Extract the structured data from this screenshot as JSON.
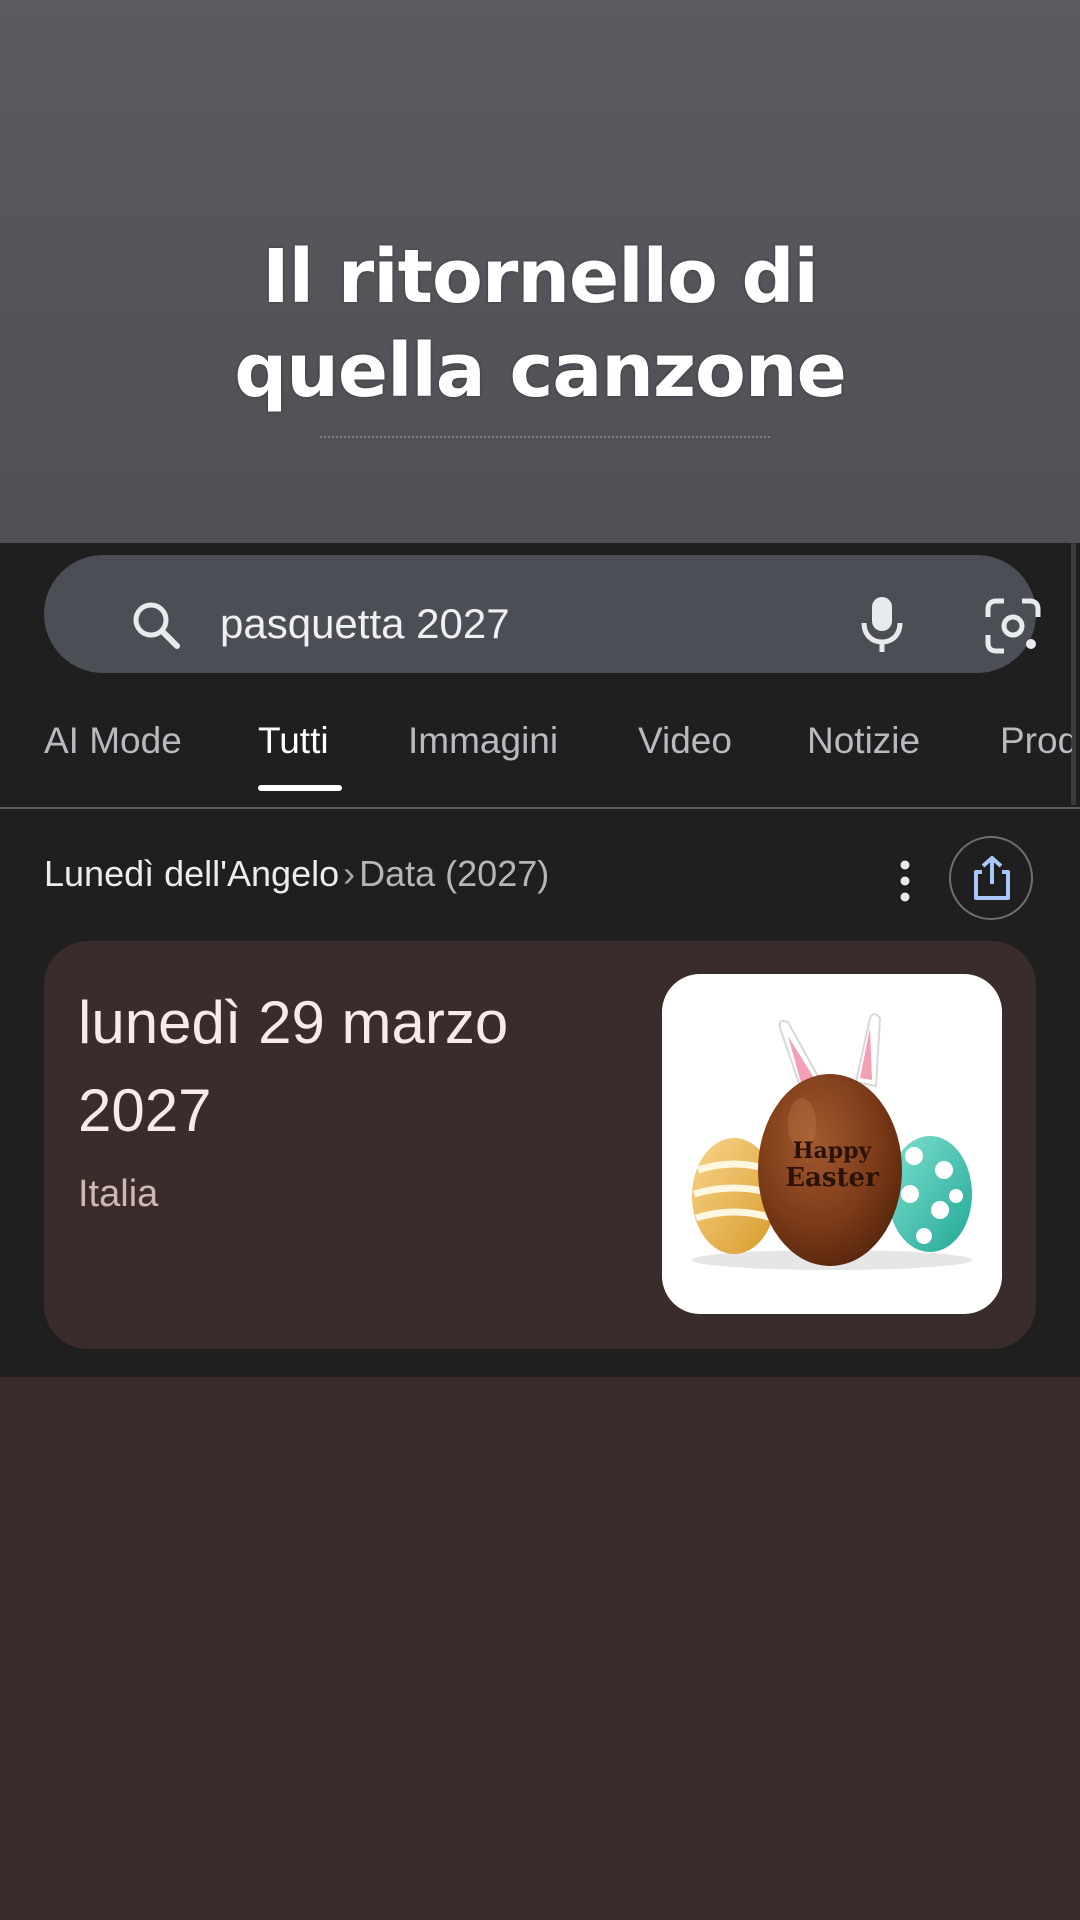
{
  "banner": {
    "caption_line1": "Il ritornello di",
    "caption_line2": "quella canzone"
  },
  "search": {
    "query": "pasquetta 2027",
    "icons": [
      "search-icon",
      "mic-icon",
      "lens-icon"
    ]
  },
  "tabs": [
    {
      "label": "AI Mode",
      "active": false
    },
    {
      "label": "Tutti",
      "active": true
    },
    {
      "label": "Immagini",
      "active": false
    },
    {
      "label": "Video",
      "active": false
    },
    {
      "label": "Notizie",
      "active": false
    },
    {
      "label": "Prod",
      "active": false
    }
  ],
  "breadcrumb": {
    "title": "Lunedì dell'Angelo",
    "separator": "›",
    "subtitle": "Data (2027)"
  },
  "result": {
    "date_line1": "lunedì 29 marzo",
    "date_line2": "2027",
    "region": "Italia",
    "image_text_line1": "Happy",
    "image_text_line2": "Easter"
  },
  "colors": {
    "banner_bg": "#56585e",
    "panel_bg": "#1f1f1f",
    "search_bar_bg": "#4b4e55",
    "card_bg": "#3a2c2a",
    "page_bg": "#3a2c2a"
  }
}
